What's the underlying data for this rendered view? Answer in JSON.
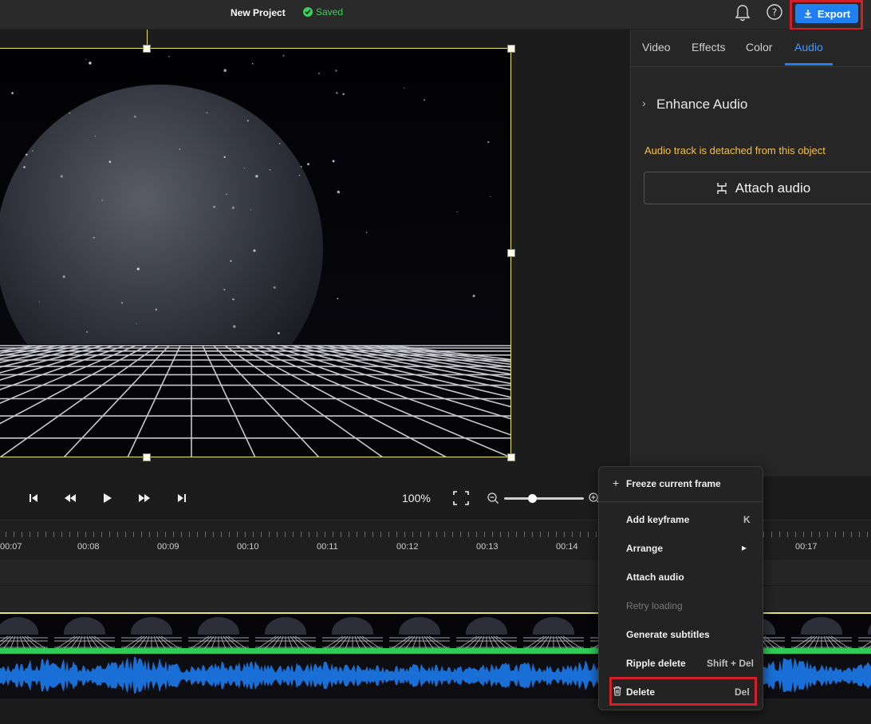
{
  "header": {
    "project_title": "New Project",
    "saved_status": "Saved",
    "export_label": "Export"
  },
  "right_panel": {
    "tabs": [
      {
        "label": "Video"
      },
      {
        "label": "Effects"
      },
      {
        "label": "Color"
      },
      {
        "label": "Audio",
        "active": true
      }
    ],
    "enhance_title": "Enhance Audio",
    "detached_note": "Audio track is detached from this object",
    "attach_button": "Attach audio"
  },
  "transport": {
    "zoom_percent": "100%",
    "zoom_slider_level": 0.35
  },
  "timeline": {
    "ticks": [
      "00:07",
      "00:08",
      "00:09",
      "00:10",
      "00:11",
      "00:12",
      "00:13",
      "00:14",
      "00:17"
    ]
  },
  "context_menu": {
    "items": [
      {
        "label": "Freeze current frame",
        "shortcut": ""
      },
      {
        "label": "Add keyframe",
        "shortcut": "K"
      },
      {
        "label": "Arrange",
        "shortcut": "▸"
      },
      {
        "label": "Attach audio",
        "shortcut": ""
      },
      {
        "label": "Retry loading",
        "shortcut": "",
        "disabled": true
      },
      {
        "label": "Generate subtitles",
        "shortcut": ""
      },
      {
        "label": "Ripple delete",
        "shortcut": "Shift + Del"
      },
      {
        "label": "Delete",
        "shortcut": "Del"
      }
    ]
  },
  "colors": {
    "accent": "#1f7ff0",
    "saved_green": "#3ecf5a",
    "warning": "#f5c04a",
    "highlight_red": "#d1202a",
    "selection_yellow": "#e8e56a",
    "waveform_blue": "#1a6fd6"
  }
}
